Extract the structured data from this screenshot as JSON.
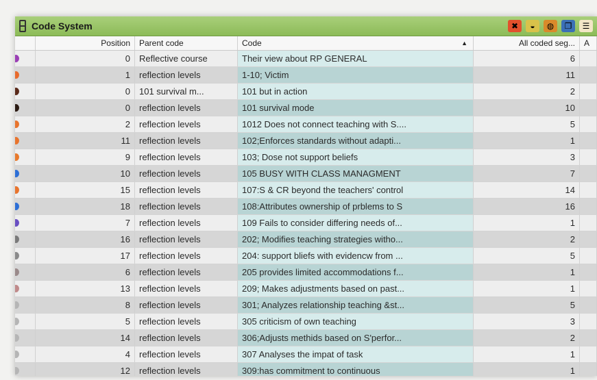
{
  "window": {
    "title": "Code System",
    "toolbar_icons": [
      {
        "name": "close-x-icon",
        "color": "#e2502c",
        "glyph": "✖"
      },
      {
        "name": "new-code-icon",
        "color": "#d9c24a",
        "glyph": "◒"
      },
      {
        "name": "expand-icon",
        "color": "#d98a2a",
        "glyph": "◍"
      },
      {
        "name": "copy-icon",
        "color": "#3b70b6",
        "glyph": "❐"
      },
      {
        "name": "settings-icon",
        "color": "#f2e6c6",
        "glyph": "☰"
      }
    ]
  },
  "table": {
    "headers": {
      "position": "Position",
      "parent_code": "Parent code",
      "code": "Code",
      "all_coded_segments": "All coded seg...",
      "extra": "A"
    },
    "rows": [
      {
        "dot": "#9b3fb5",
        "position": "0",
        "parent": "Reflective course",
        "code": "Their view about RP GENERAL",
        "segments": "6"
      },
      {
        "dot": "#e86b2d",
        "position": "1",
        "parent": "reflection levels",
        "code": "1-10; Victim",
        "segments": "11"
      },
      {
        "dot": "#5a2a1a",
        "position": "0",
        "parent": "101 survival m...",
        "code": "101 but in action",
        "segments": "2"
      },
      {
        "dot": "#2a1a12",
        "position": "0",
        "parent": "reflection levels",
        "code": "101 survival mode",
        "segments": "10"
      },
      {
        "dot": "#e8742d",
        "position": "2",
        "parent": "reflection levels",
        "code": "1012 Does not connect teaching with S....",
        "segments": "5"
      },
      {
        "dot": "#e8742d",
        "position": "11",
        "parent": "reflection levels",
        "code": "102;Enforces standards  without adapti...",
        "segments": "1"
      },
      {
        "dot": "#e87a2d",
        "position": "9",
        "parent": "reflection levels",
        "code": "103; Dose not support beliefs",
        "segments": "3"
      },
      {
        "dot": "#2d6fd6",
        "position": "10",
        "parent": "reflection levels",
        "code": "105 BUSY WITH CLASS MANAGMENT",
        "segments": "7"
      },
      {
        "dot": "#e8742d",
        "position": "15",
        "parent": "reflection levels",
        "code": "107:S & CR beyond the teachers' control",
        "segments": "14"
      },
      {
        "dot": "#2d6fd6",
        "position": "18",
        "parent": "reflection levels",
        "code": "108:Attributes ownership of prblems to S",
        "segments": "16"
      },
      {
        "dot": "#6a4fc2",
        "position": "7",
        "parent": "reflection levels",
        "code": "109  Fails to consider differing needs of...",
        "segments": "1"
      },
      {
        "dot": "#7a7a7a",
        "position": "16",
        "parent": "reflection levels",
        "code": "202; Modifies teaching strategies witho...",
        "segments": "2"
      },
      {
        "dot": "#8a8a8a",
        "position": "17",
        "parent": "reflection levels",
        "code": "204: support bliefs with evidencw from ...",
        "segments": "5"
      },
      {
        "dot": "#9a8a8a",
        "position": "6",
        "parent": "reflection levels",
        "code": "205 provides limited accommodations f...",
        "segments": "1"
      },
      {
        "dot": "#c08a8a",
        "position": "13",
        "parent": "reflection levels",
        "code": "209; Makes adjustments based on past...",
        "segments": "1"
      },
      {
        "dot": "#b5b5b5",
        "position": "8",
        "parent": "reflection levels",
        "code": "301; Analyzes relationship teaching &st...",
        "segments": "5"
      },
      {
        "dot": "#b5b5b5",
        "position": "5",
        "parent": "reflection levels",
        "code": "305 criticism of own teaching",
        "segments": "3"
      },
      {
        "dot": "#b5b5b5",
        "position": "14",
        "parent": "reflection levels",
        "code": "306;Adjusts methids based on S'perfor...",
        "segments": "2"
      },
      {
        "dot": "#b5b5b5",
        "position": "4",
        "parent": "reflection levels",
        "code": "307 Analyses the impat of task",
        "segments": "1"
      },
      {
        "dot": "#b5b5b5",
        "position": "12",
        "parent": "reflection levels",
        "code": "309:has commitment to continuous",
        "segments": "1"
      }
    ]
  }
}
